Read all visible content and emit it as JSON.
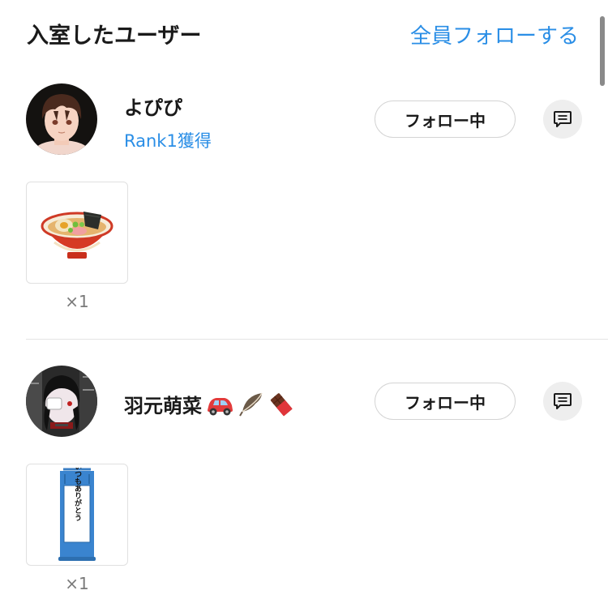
{
  "header": {
    "title": "入室したユーザー",
    "follow_all_label": "全員フォローする"
  },
  "users": [
    {
      "name": "よぴぴ",
      "rank": "Rank1獲得",
      "follow_label": "フォロー中",
      "gift": {
        "item": "ramen-bowl",
        "count": "×1"
      }
    },
    {
      "name": "羽元萌菜",
      "name_emojis": [
        "car-emoji",
        "feather-emoji",
        "chocolate-emoji"
      ],
      "follow_label": "フォロー中",
      "gift": {
        "item": "hanging-scroll",
        "count": "×1",
        "scroll_text": "いつもありがとう"
      }
    }
  ],
  "colors": {
    "accent": "#2a8ee6",
    "text": "#1a1a1a",
    "muted": "#7a7a7a",
    "border": "#d4d4d4"
  }
}
